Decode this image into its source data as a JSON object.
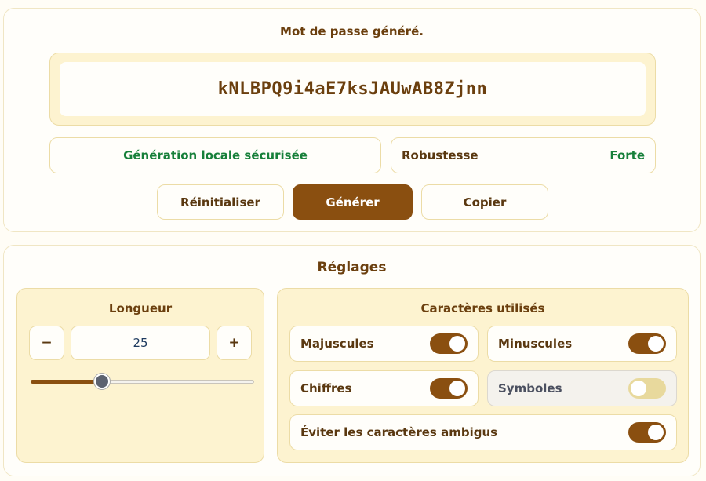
{
  "generator": {
    "title": "Mot de passe généré.",
    "password": "kNLBPQ9i4aE7ksJAUwAB8Zjnn",
    "local_label": "Génération locale sécurisée",
    "strength_label": "Robustesse",
    "strength_value": "Forte",
    "buttons": {
      "reset": "Réinitialiser",
      "generate": "Générer",
      "copy": "Copier"
    }
  },
  "settings": {
    "title": "Réglages",
    "length": {
      "title": "Longueur",
      "minus": "−",
      "plus": "+",
      "value": "25",
      "slider_fraction": 0.32
    },
    "chars": {
      "title": "Caractères utilisés",
      "uppercase": {
        "label": "Majuscules",
        "enabled": true
      },
      "lowercase": {
        "label": "Minuscules",
        "enabled": true
      },
      "digits": {
        "label": "Chiffres",
        "enabled": true
      },
      "symbols": {
        "label": "Symboles",
        "enabled": false
      },
      "avoid_ambiguous": {
        "label": "Éviter les caractères ambigus",
        "enabled": true
      }
    }
  },
  "colors": {
    "accent": "#8a4f10",
    "success": "#17803a",
    "panel": "#fdf3d0"
  }
}
